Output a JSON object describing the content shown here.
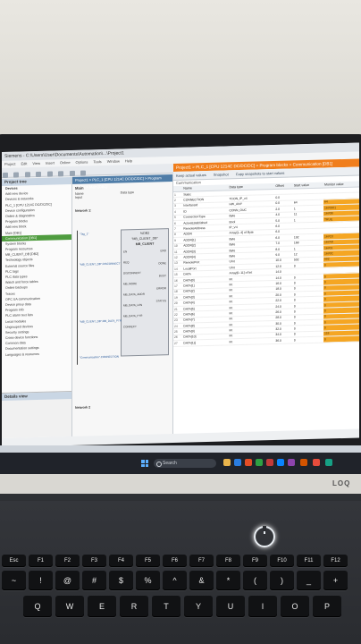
{
  "screen": {
    "window_title": "Siemens - C:\\Users\\User\\Documents\\Automation\\...\\Project1",
    "menu": [
      "Project",
      "Edit",
      "View",
      "Insert",
      "Online",
      "Options",
      "Tools",
      "Window",
      "Help"
    ],
    "go_online": "Go offline",
    "tree": {
      "header": "Project tree",
      "title": "Devices",
      "items": [
        {
          "label": "Add new device"
        },
        {
          "label": "Devices & networks"
        },
        {
          "label": "PLC_1 [CPU 1214C DC/DC/DC]"
        },
        {
          "label": "Device configuration"
        },
        {
          "label": "Online & diagnostics"
        },
        {
          "label": "Program blocks"
        },
        {
          "label": "Add new block"
        },
        {
          "label": "Main [OB1]"
        },
        {
          "label": "Communication [DB1]",
          "selected": true
        },
        {
          "label": "System blocks"
        },
        {
          "label": "Program resources"
        },
        {
          "label": "MB_CLIENT_DB [DB2]"
        },
        {
          "label": "Technology objects"
        },
        {
          "label": "External source files"
        },
        {
          "label": "PLC tags"
        },
        {
          "label": "PLC data types"
        },
        {
          "label": "Watch and force tables"
        },
        {
          "label": "Online backups"
        },
        {
          "label": "Traces"
        },
        {
          "label": "OPC UA communication"
        },
        {
          "label": "Device proxy data"
        },
        {
          "label": "Program info"
        },
        {
          "label": "PLC alarm text lists"
        },
        {
          "label": "Local modules"
        },
        {
          "label": "Ungrouped devices"
        },
        {
          "label": "Security settings"
        },
        {
          "label": "Cross-device functions"
        },
        {
          "label": "Common data"
        },
        {
          "label": "Documentation settings"
        },
        {
          "label": "Languages & resources"
        }
      ],
      "details_header": "Details view"
    },
    "editor": {
      "tab": "Project1 > PLC_1 [CPU 1214C DC/DC/DC] > Program blocks > Main [OB1]",
      "block_title": "Main",
      "col_name": "Name",
      "col_type": "Data type",
      "input_label": "Input",
      "network1": "Network 1:",
      "network2": "Network 2",
      "block_db": "%DB2",
      "block_db_name": "\"MB_CLIENT_DB\"",
      "block_name": "MB_CLIENT",
      "pins_left": [
        "EN",
        "REQ",
        "DISCONNECT",
        "MB_MODE",
        "MB_DATA_ADDR",
        "MB_DATA_LEN",
        "MB_DATA_PTR",
        "CONNECT"
      ],
      "pins_right": [
        "ENO",
        "DONE",
        "BUSY",
        "ERROR",
        "STATUS"
      ],
      "param_left": [
        "\"Tag_1\"",
        "\"MB_CLIENT_DB\".DISCONNECT",
        "\"MB_CLIENT_DB\".MB_DATA_PTR",
        "\"Communication\".CONNECTION"
      ]
    },
    "db": {
      "tab": "Project1 > PLC_1 [CPU 1214C DC/DC/DC] > Program blocks > Communication [DB1]",
      "toolbar": [
        "Keep actual values",
        "Snapshot",
        "Copy snapshots to start values"
      ],
      "title": "Communication",
      "columns": [
        "Name",
        "Data type",
        "Offset",
        "Start value",
        "Monitor value"
      ],
      "rows": [
        {
          "n": "1",
          "name": "Static",
          "type": "",
          "offset": "",
          "start": "",
          "mon": ""
        },
        {
          "n": "2",
          "name": "CONNECTION",
          "type": "TCON_IP_v4",
          "offset": "0.0",
          "start": "",
          "mon": ""
        },
        {
          "n": "3",
          "name": "InterfaceId",
          "type": "HW_ANY",
          "offset": "0.0",
          "start": "64",
          "mon": "64"
        },
        {
          "n": "4",
          "name": "ID",
          "type": "CONN_OUC",
          "offset": "2.0",
          "start": "1",
          "mon": "16#0001"
        },
        {
          "n": "5",
          "name": "ConnectionType",
          "type": "Byte",
          "offset": "4.0",
          "start": "11",
          "mon": "16#0B"
        },
        {
          "n": "6",
          "name": "ActiveEstablished",
          "type": "Bool",
          "offset": "5.0",
          "start": "1",
          "mon": "TRUE"
        },
        {
          "n": "7",
          "name": "RemoteAddress",
          "type": "IP_V4",
          "offset": "6.0",
          "start": "",
          "mon": ""
        },
        {
          "n": "8",
          "name": "ADDR",
          "type": "Array[1..4] of Byte",
          "offset": "6.0",
          "start": "",
          "mon": ""
        },
        {
          "n": "9",
          "name": "ADDR[1]",
          "type": "Byte",
          "offset": "6.0",
          "start": "192",
          "mon": "16#C0"
        },
        {
          "n": "10",
          "name": "ADDR[2]",
          "type": "Byte",
          "offset": "7.0",
          "start": "168",
          "mon": "16#A8"
        },
        {
          "n": "11",
          "name": "ADDR[3]",
          "type": "Byte",
          "offset": "8.0",
          "start": "1",
          "mon": "16#01"
        },
        {
          "n": "12",
          "name": "ADDR[4]",
          "type": "Byte",
          "offset": "9.0",
          "start": "12",
          "mon": "16#0C"
        },
        {
          "n": "13",
          "name": "RemotePort",
          "type": "UInt",
          "offset": "10.0",
          "start": "502",
          "mon": "502"
        },
        {
          "n": "14",
          "name": "LocalPort",
          "type": "UInt",
          "offset": "12.0",
          "start": "0",
          "mon": "0"
        },
        {
          "n": "15",
          "name": "DATA",
          "type": "Array[0..11] of Int",
          "offset": "14.0",
          "start": "",
          "mon": ""
        },
        {
          "n": "16",
          "name": "DATA[0]",
          "type": "Int",
          "offset": "14.0",
          "start": "0",
          "mon": "0"
        },
        {
          "n": "17",
          "name": "DATA[1]",
          "type": "Int",
          "offset": "16.0",
          "start": "0",
          "mon": "0"
        },
        {
          "n": "18",
          "name": "DATA[2]",
          "type": "Int",
          "offset": "18.0",
          "start": "0",
          "mon": "0"
        },
        {
          "n": "19",
          "name": "DATA[3]",
          "type": "Int",
          "offset": "20.0",
          "start": "0",
          "mon": "0"
        },
        {
          "n": "20",
          "name": "DATA[4]",
          "type": "Int",
          "offset": "22.0",
          "start": "0",
          "mon": "0"
        },
        {
          "n": "21",
          "name": "DATA[5]",
          "type": "Int",
          "offset": "24.0",
          "start": "0",
          "mon": "0"
        },
        {
          "n": "22",
          "name": "DATA[6]",
          "type": "Int",
          "offset": "26.0",
          "start": "0",
          "mon": "0"
        },
        {
          "n": "23",
          "name": "DATA[7]",
          "type": "Int",
          "offset": "28.0",
          "start": "0",
          "mon": "0"
        },
        {
          "n": "24",
          "name": "DATA[8]",
          "type": "Int",
          "offset": "30.0",
          "start": "0",
          "mon": "0"
        },
        {
          "n": "25",
          "name": "DATA[9]",
          "type": "Int",
          "offset": "32.0",
          "start": "0",
          "mon": "0"
        },
        {
          "n": "26",
          "name": "DATA[10]",
          "type": "Int",
          "offset": "34.0",
          "start": "0",
          "mon": "118"
        },
        {
          "n": "27",
          "name": "DATA[11]",
          "type": "Int",
          "offset": "36.0",
          "start": "0",
          "mon": "0"
        }
      ]
    },
    "taskbar_items": [
      "Overview",
      "PLC_1",
      "Main [OB1]",
      "Communication ...",
      "Watch & force ..."
    ],
    "search_label": "Search",
    "accent_color": "#f07e1c",
    "monitor_color": "#f5a623"
  },
  "laptop": {
    "brand": "LOQ",
    "keys_row1": [
      "Esc",
      "F1",
      "F2",
      "F3",
      "F4",
      "F5",
      "F6",
      "F7",
      "F8",
      "F9",
      "F10",
      "F11",
      "F12"
    ],
    "keys_row2": [
      "~",
      "!",
      "@",
      "#",
      "$",
      "%",
      "^",
      "&",
      "*",
      "(",
      ")",
      "_",
      "+"
    ],
    "keys_row3": [
      "Q",
      "W",
      "E",
      "R",
      "T",
      "Y",
      "U",
      "I",
      "O",
      "P"
    ],
    "power_icon": "power-icon"
  }
}
